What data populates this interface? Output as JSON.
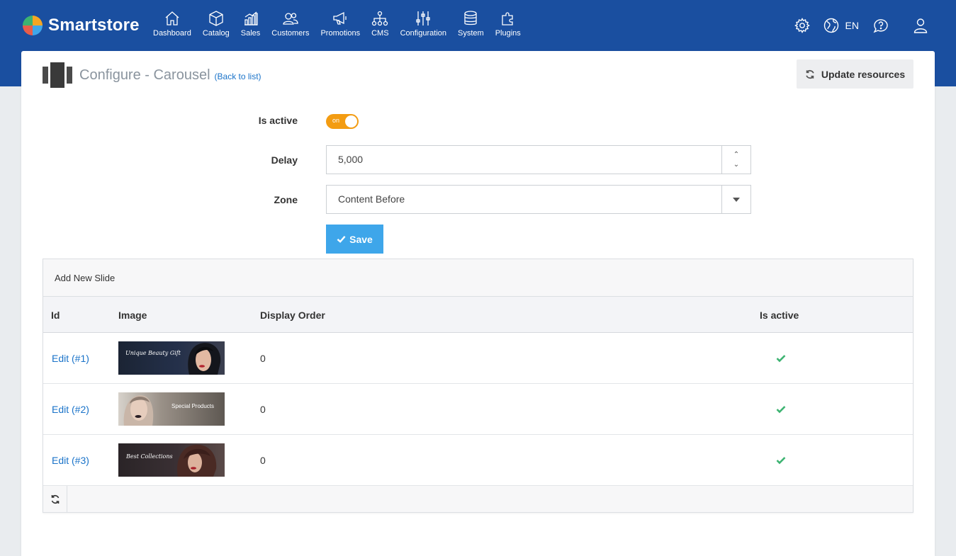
{
  "app": {
    "name": "Smartstore"
  },
  "nav": [
    {
      "label": "Dashboard",
      "icon": "home-icon"
    },
    {
      "label": "Catalog",
      "icon": "box-icon"
    },
    {
      "label": "Sales",
      "icon": "chart-icon"
    },
    {
      "label": "Customers",
      "icon": "users-icon"
    },
    {
      "label": "Promotions",
      "icon": "megaphone-icon"
    },
    {
      "label": "CMS",
      "icon": "sitemap-icon"
    },
    {
      "label": "Configuration",
      "icon": "sliders-icon"
    },
    {
      "label": "System",
      "icon": "database-icon"
    },
    {
      "label": "Plugins",
      "icon": "puzzle-icon"
    }
  ],
  "header_right": {
    "language": "EN"
  },
  "page": {
    "title": "Configure - Carousel",
    "back_link": "(Back to list)",
    "update_button": "Update resources"
  },
  "form": {
    "is_active_label": "Is active",
    "is_active_toggle": "on",
    "delay_label": "Delay",
    "delay_value": "5,000",
    "zone_label": "Zone",
    "zone_value": "Content Before",
    "save_label": "Save"
  },
  "grid": {
    "toolbar_label": "Add New Slide",
    "columns": [
      "Id",
      "Image",
      "Display Order",
      "Is active"
    ],
    "rows": [
      {
        "edit": "Edit (#1)",
        "image_text": "Unique Beauty Gift",
        "order": "0",
        "active": true
      },
      {
        "edit": "Edit (#2)",
        "image_text": "Special Products",
        "order": "0",
        "active": true
      },
      {
        "edit": "Edit (#3)",
        "image_text": "Best Collections",
        "order": "0",
        "active": true
      }
    ]
  },
  "colors": {
    "header": "#1a4fa0",
    "accent_orange": "#f39c12",
    "save_blue": "#3ea6ea",
    "link": "#1a73c9",
    "check_green": "#3cb371"
  }
}
